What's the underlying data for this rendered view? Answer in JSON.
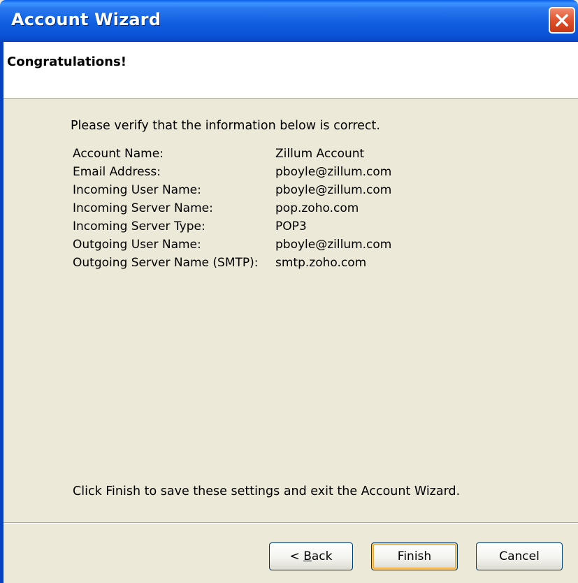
{
  "window": {
    "title": "Account Wizard"
  },
  "header": {
    "title": "Congratulations!"
  },
  "content": {
    "intro": "Please verify that the information below is correct.",
    "rows": [
      {
        "label": "Account Name:",
        "value": "Zillum Account"
      },
      {
        "label": "Email Address:",
        "value": "pboyle@zillum.com"
      },
      {
        "label": "Incoming User Name:",
        "value": "pboyle@zillum.com"
      },
      {
        "label": "Incoming Server Name:",
        "value": "pop.zoho.com"
      },
      {
        "label": "Incoming Server Type:",
        "value": "POP3"
      },
      {
        "label": "Outgoing User Name:",
        "value": "pboyle@zillum.com"
      },
      {
        "label": "Outgoing Server Name (SMTP):",
        "value": "smtp.zoho.com"
      }
    ],
    "footer": "Click Finish to save these settings and exit the Account Wizard."
  },
  "buttons": {
    "back_prefix": "< ",
    "back_mnemonic": "B",
    "back_rest": "ack",
    "finish": "Finish",
    "cancel": "Cancel"
  },
  "icons": {
    "close": "close-icon"
  },
  "colors": {
    "title_bar": "#0a52d6",
    "close_button": "#e0522e",
    "dialog_background": "#ece9d8",
    "header_background": "#ffffff",
    "default_button_highlight": "#f5c96b"
  }
}
